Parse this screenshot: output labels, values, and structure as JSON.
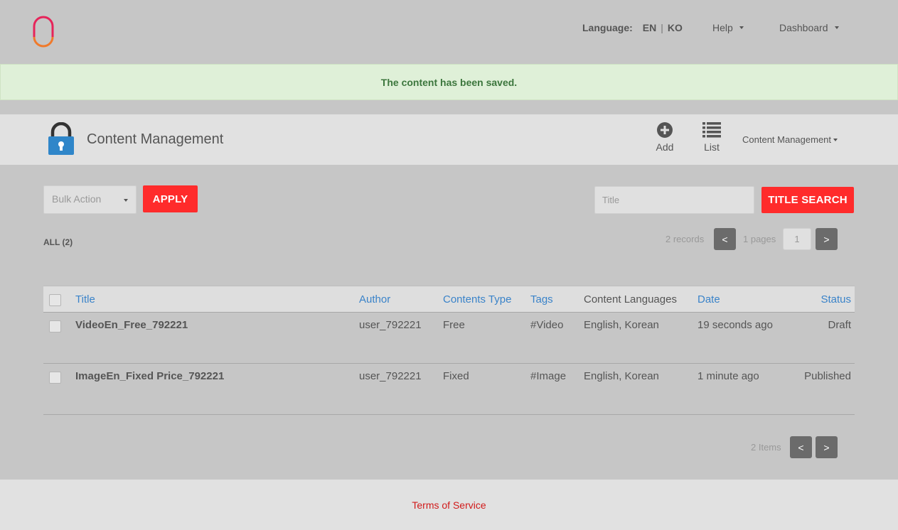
{
  "colors": {
    "accent": "#ff2b2b",
    "alert_bg": "#dff0d8",
    "alert_text": "#3c763d",
    "link": "#3a83c9",
    "page_bg": "#c6c6c6",
    "icon_gray": "#555555",
    "lock_blue": "#2f86c9"
  },
  "header": {
    "logo_icon": "brand-logo-icon",
    "language_label": "Language:",
    "languages": [
      "EN",
      "KO"
    ],
    "lang_separator": "|",
    "help_label": "Help",
    "dashboard_label": "Dashboard"
  },
  "alert": {
    "message": "The content has been saved."
  },
  "section": {
    "icon": "padlock-icon",
    "title": "Content Management",
    "actions": [
      {
        "label": "Add",
        "icon": "plus-circle-icon"
      },
      {
        "label": "List",
        "icon": "list-icon"
      }
    ],
    "menu_label": "Content Management"
  },
  "toolbar": {
    "bulk_action_placeholder": "Bulk Action",
    "apply_label": "APPLY",
    "title_placeholder": "Title",
    "title_value": "",
    "title_search_label": "TITLE SEARCH"
  },
  "summary": {
    "all_label": "ALL (2)",
    "records_text": "2 records",
    "prev_label": "<",
    "pages_text": "1 pages",
    "page_value": "1",
    "next_label": ">"
  },
  "table": {
    "columns": [
      "Title",
      "Author",
      "Contents Type",
      "Tags",
      "Content Languages",
      "Date",
      "Status"
    ],
    "rows": [
      {
        "title": "VideoEn_Free_792221",
        "author": "user_792221",
        "type": "Free",
        "tags": "#Video",
        "languages": "English, Korean",
        "date": "19 seconds ago",
        "status": "Draft"
      },
      {
        "title": "ImageEn_Fixed Price_792221",
        "author": "user_792221",
        "type": "Fixed",
        "tags": "#Image",
        "languages": "English, Korean",
        "date": "1 minute ago",
        "status": "Published"
      }
    ]
  },
  "bottom_pager": {
    "items_text": "2 Items",
    "prev_label": "<",
    "next_label": ">"
  },
  "footer": {
    "terms_label": "Terms of Service"
  }
}
